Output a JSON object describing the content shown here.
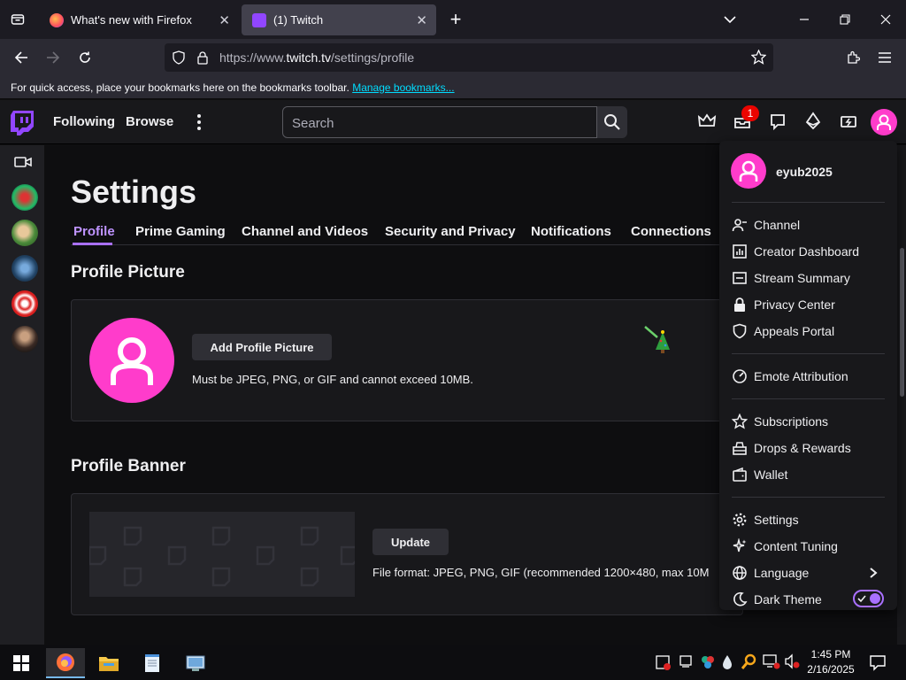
{
  "browser": {
    "tabs": [
      {
        "label": "What's new with Firefox",
        "active": false
      },
      {
        "label": "(1) Twitch",
        "active": true
      }
    ],
    "url_prefix": "https://www.",
    "url_domain": "twitch.tv",
    "url_path": "/settings/profile",
    "bookmarks_message": "For quick access, place your bookmarks here on the bookmarks toolbar.",
    "bookmarks_link": "Manage bookmarks..."
  },
  "twitch_nav": {
    "following": "Following",
    "browse": "Browse",
    "search_placeholder": "Search",
    "notification_count": "1"
  },
  "settings": {
    "title": "Settings",
    "tabs": [
      "Profile",
      "Prime Gaming",
      "Channel and Videos",
      "Security and Privacy",
      "Notifications",
      "Connections"
    ],
    "active_tab": "Profile",
    "profile_picture": {
      "heading": "Profile Picture",
      "button": "Add Profile Picture",
      "note": "Must be JPEG, PNG, or GIF and cannot exceed 10MB."
    },
    "profile_banner": {
      "heading": "Profile Banner",
      "button": "Update",
      "note": "File format: JPEG, PNG, GIF (recommended 1200×480, max 10M"
    }
  },
  "menu": {
    "username": "eyub2025",
    "items": [
      "Channel",
      "Creator Dashboard",
      "Stream Summary",
      "Privacy Center",
      "Appeals Portal",
      "Emote Attribution",
      "Subscriptions",
      "Drops & Rewards",
      "Wallet",
      "Settings",
      "Content Tuning",
      "Language",
      "Dark Theme"
    ],
    "dark_theme_on": true
  },
  "taskbar": {
    "time": "1:45 PM",
    "date": "2/16/2025"
  },
  "colors": {
    "twitch_purple": "#9146ff",
    "accent_purple": "#a970ff",
    "avatar_pink": "#ff3ccb",
    "badge_red": "#eb0400"
  }
}
